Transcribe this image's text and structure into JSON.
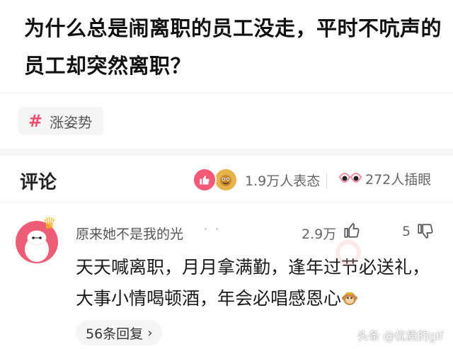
{
  "question": {
    "title": "为什么总是闹离职的员工没走，平时不吭声的员工却突然离职？"
  },
  "topic": {
    "icon": "hash-icon",
    "hash": "#",
    "label": "涨姿势"
  },
  "comments_header": {
    "title": "评论",
    "reactions_count": "1.9万人表态",
    "illustrations_count": "272人插眼"
  },
  "comment": {
    "username": "原来她不是我的光",
    "user_badge_dots": "· ·",
    "like_count": "2.9万",
    "dislike_count": "5",
    "body": "天天喊离职，月月拿满勤，逢年过节必送礼，大事小情喝顿酒，年会必唱感恩心",
    "replies_label": "56条回复",
    "chevron": "›"
  },
  "footer": {
    "source": "头条 @优质的gif"
  },
  "colors": {
    "accent_pink": "#f04e6e",
    "like_pink": "#f45a78",
    "avatar_red": "#ee5d76",
    "muted_text": "#666666"
  }
}
